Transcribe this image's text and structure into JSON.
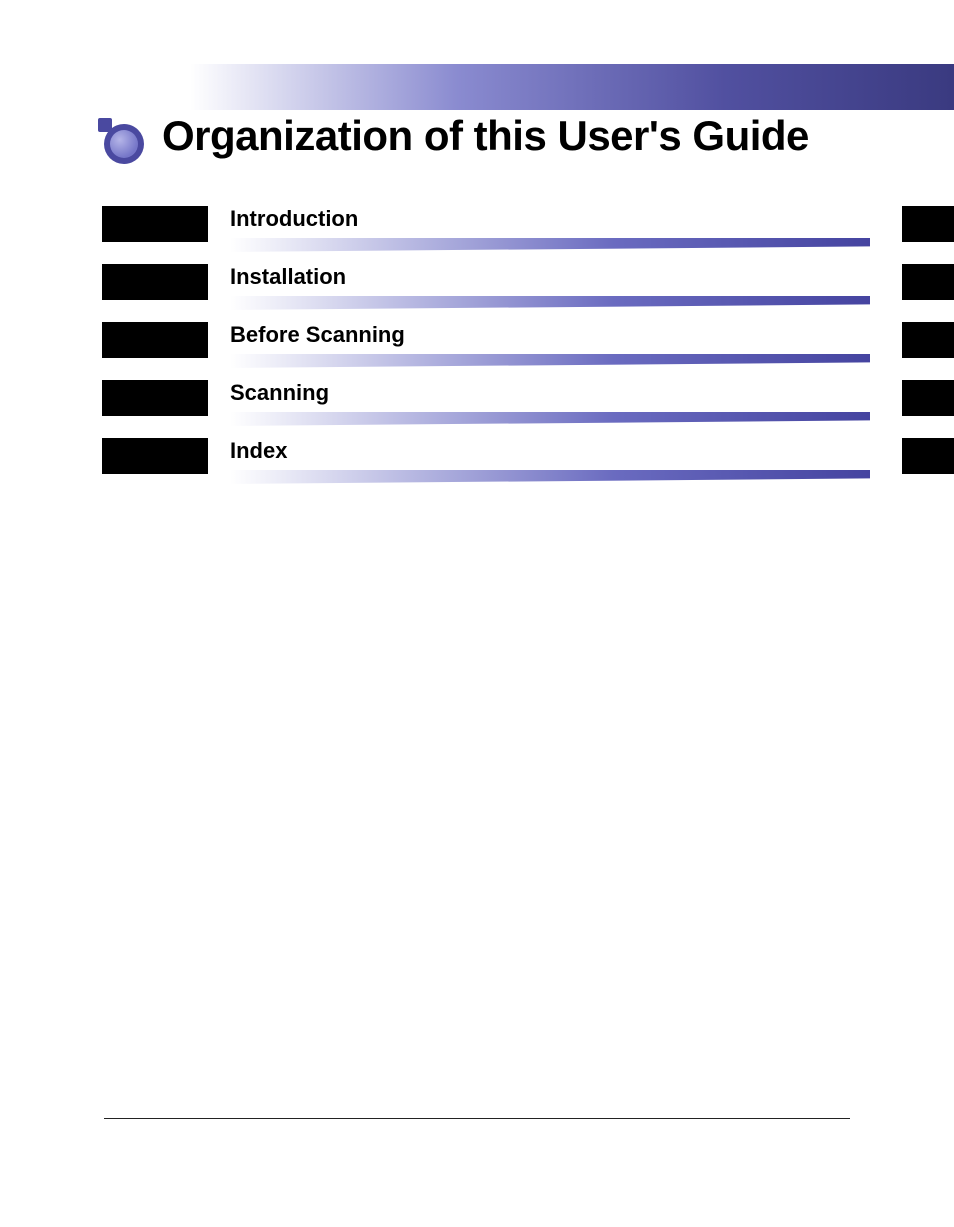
{
  "header": {
    "title": "Organization of this User's Guide"
  },
  "sections": [
    {
      "label": "Introduction"
    },
    {
      "label": "Installation"
    },
    {
      "label": "Before Scanning"
    },
    {
      "label": "Scanning"
    },
    {
      "label": "Index"
    }
  ]
}
